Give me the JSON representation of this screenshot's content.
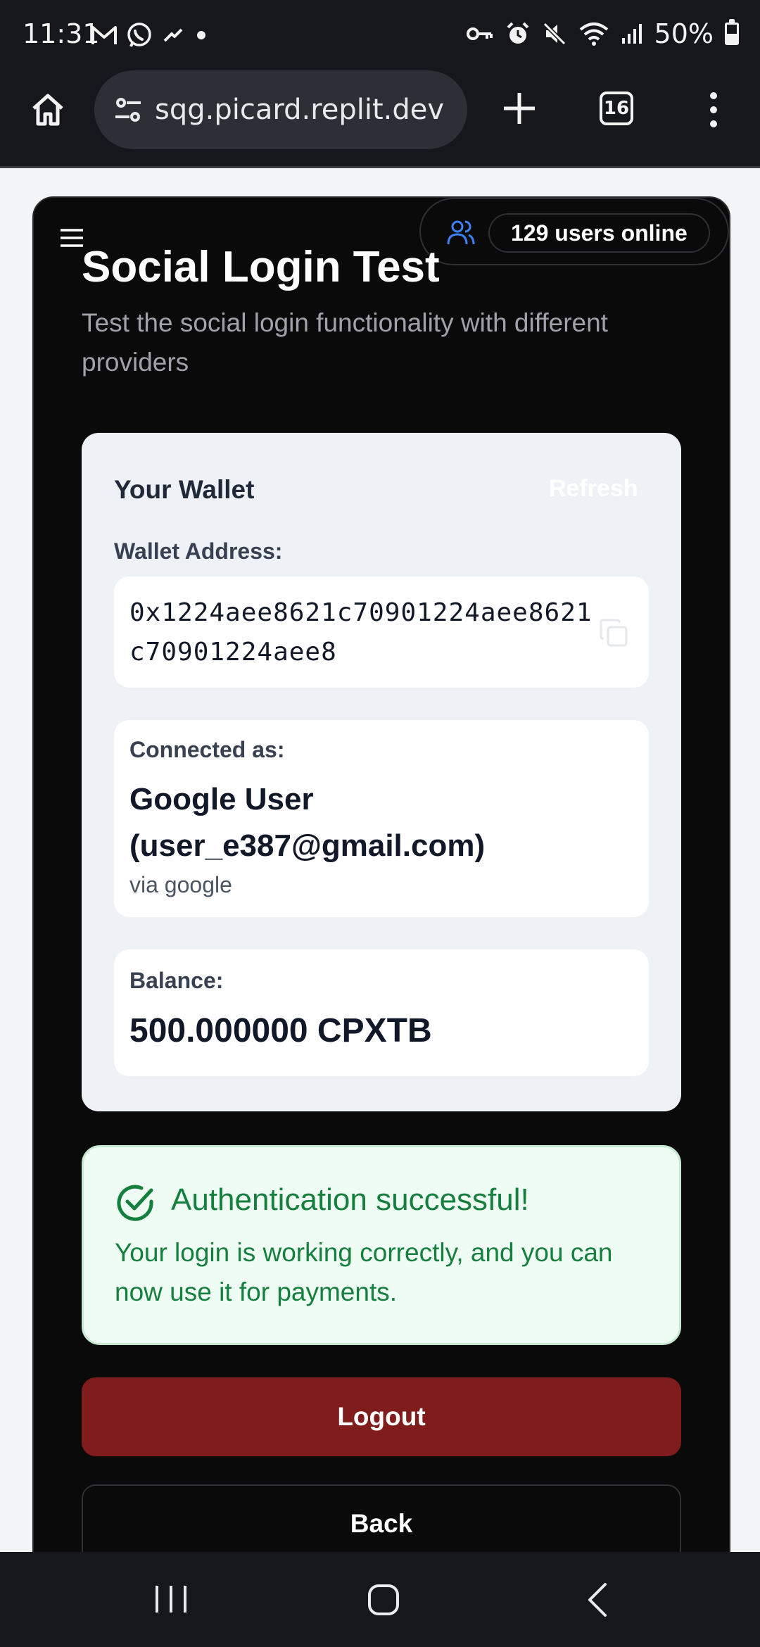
{
  "status_bar": {
    "time": "11:31",
    "battery": "50%",
    "battery_level": 0.5,
    "left_icons": [
      "gmail-icon",
      "whatsapp-icon",
      "messenger-icon",
      "dot-icon"
    ],
    "right_icons": [
      "key-icon",
      "alarm-icon",
      "mute-icon",
      "wifi-icon",
      "signal-icon",
      "battery-icon"
    ]
  },
  "browser": {
    "url": "sqg.picard.replit.dev",
    "tab_count": "16",
    "icons": [
      "home-icon",
      "site-settings-icon",
      "new-tab-icon",
      "tabs-icon",
      "more-menu-icon"
    ]
  },
  "header": {
    "online_count": "129 users online",
    "title": "Social Login Test",
    "subtitle": "Test the social login functionality with different providers"
  },
  "wallet": {
    "title": "Your Wallet",
    "refresh_label": "Refresh",
    "address_label": "Wallet Address:",
    "address": "0x1224aee8621c70901224aee8621c70901224aee8",
    "connected_label": "Connected as:",
    "connected_user": "Google User (user_e387@gmail.com)",
    "connected_via": "via google",
    "balance_label": "Balance:",
    "balance_value": "500.000000 CPXTB"
  },
  "success": {
    "title": "Authentication successful!",
    "message": "Your login is working correctly, and you can now use it for payments.",
    "color": "#15803d"
  },
  "actions": {
    "logout_label": "Logout",
    "back_label": "Back",
    "logout_color": "#7f1d1d"
  }
}
